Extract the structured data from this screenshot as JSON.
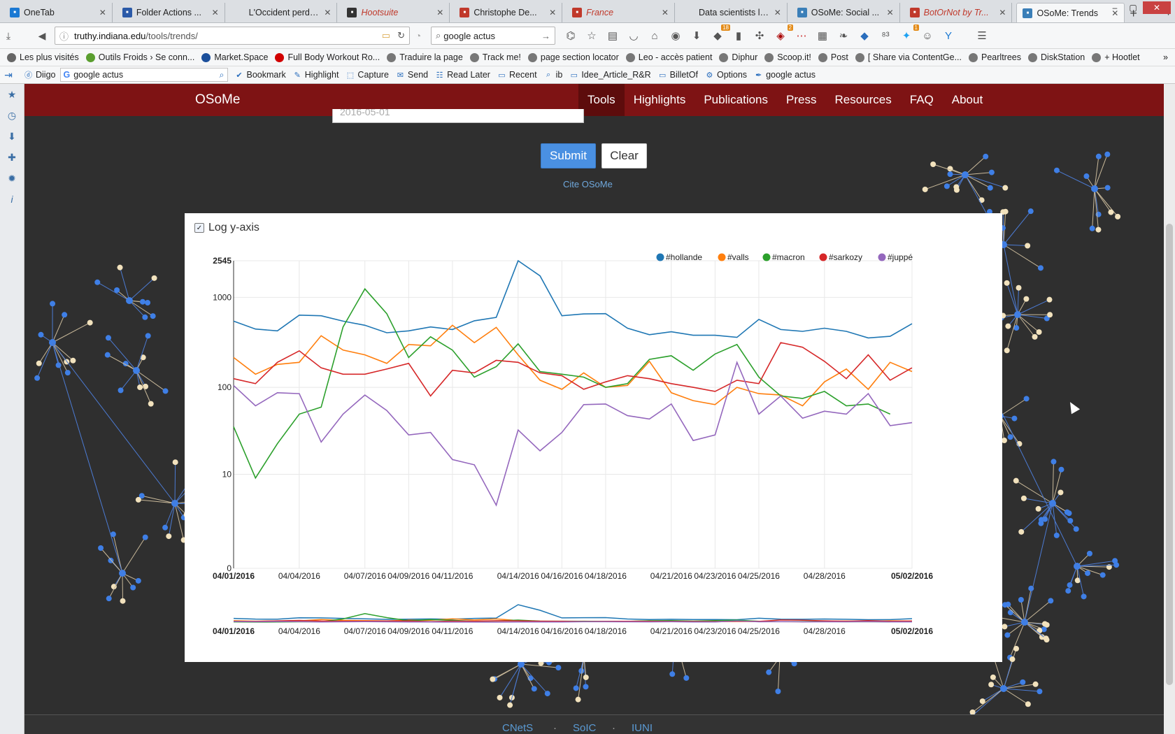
{
  "browser": {
    "tabs": [
      {
        "title": "OneTab",
        "icon": "onetab-icon",
        "color": "#1b79d3",
        "style": ""
      },
      {
        "title": "Folder Actions ...",
        "icon": "folder-icon",
        "color": "#2b5aa8",
        "style": ""
      },
      {
        "title": "L'Occident perdra ?",
        "icon": "",
        "color": "",
        "style": ""
      },
      {
        "title": "Hootsuite",
        "icon": "hootsuite-icon",
        "color": "#333333",
        "style": "red"
      },
      {
        "title": "Christophe De...",
        "icon": "page-icon",
        "color": "#c0392b",
        "style": ""
      },
      {
        "title": "France",
        "icon": "doc-icon",
        "color": "#c0392b",
        "style": "red"
      },
      {
        "title": "Data scientists laun...",
        "icon": "",
        "color": "",
        "style": ""
      },
      {
        "title": "OSoMe: Social ...",
        "icon": "truthy-icon",
        "color": "#3b7fb8",
        "style": ""
      },
      {
        "title": "BotOrNot by Tr...",
        "icon": "bird-icon",
        "color": "#c0392b",
        "style": "red"
      },
      {
        "title": "OSoMe: Trends",
        "icon": "truthy-icon",
        "color": "#3b7fb8",
        "style": "active"
      }
    ],
    "url_host": "truthy.indiana.edu",
    "url_path": "/tools/trends/",
    "search_value": "google actus",
    "badges": {
      "ext1": "18",
      "ext2": "2",
      "ext3": "1"
    },
    "bookmarks": [
      "Les plus visités",
      "Outils Froids › Se conn...",
      "Market.Space",
      "Full Body Workout Ro...",
      "Traduire la page",
      "Track me!",
      "page section locator",
      "Leo - accès patient",
      "Diphur",
      "Scoop.it!",
      "Post",
      "[ Share via ContentGe...",
      "Pearltrees",
      "DiskStation",
      "+ Hootlet"
    ],
    "diigo": {
      "label": "Diigo",
      "search_value": "google actus",
      "items": [
        "Bookmark",
        "Highlight",
        "Capture",
        "Send",
        "Read Later",
        "Recent",
        "ib",
        "Idee_Article_R&R",
        "BilletOf",
        "Options",
        "google  actus"
      ]
    }
  },
  "site": {
    "brand": "OSoMe",
    "nav": [
      "Tools",
      "Highlights",
      "Publications",
      "Press",
      "Resources",
      "FAQ",
      "About"
    ],
    "active_nav": "Tools",
    "date_value": "2016-05-01",
    "submit_label": "Submit",
    "clear_label": "Clear",
    "cite_label": "Cite OSoMe",
    "log_label": "Log y-axis",
    "footer": [
      "CNetS",
      "SoIC",
      "IUNI"
    ],
    "accent_color": "#7e1314",
    "button_color": "#4a90e2"
  },
  "chart_data": {
    "type": "line",
    "log_scale": true,
    "grid": true,
    "legend_position": "top-right",
    "ylim": [
      0,
      2545
    ],
    "yticks": [
      "2545",
      "1000",
      "100",
      "10",
      "0"
    ],
    "xticks": [
      "04/01/2016",
      "04/04/2016",
      "04/07/2016",
      "04/09/2016",
      "04/11/2016",
      "04/14/2016",
      "04/16/2016",
      "04/18/2016",
      "04/21/2016",
      "04/23/2016",
      "04/25/2016",
      "04/28/2016",
      "05/02/2016"
    ],
    "x": [
      "04/01/2016",
      "04/02/2016",
      "04/03/2016",
      "04/04/2016",
      "04/05/2016",
      "04/06/2016",
      "04/07/2016",
      "04/08/2016",
      "04/09/2016",
      "04/10/2016",
      "04/11/2016",
      "04/12/2016",
      "04/13/2016",
      "04/14/2016",
      "04/15/2016",
      "04/16/2016",
      "04/17/2016",
      "04/18/2016",
      "04/19/2016",
      "04/20/2016",
      "04/21/2016",
      "04/22/2016",
      "04/23/2016",
      "04/24/2016",
      "04/25/2016",
      "04/26/2016",
      "04/27/2016",
      "04/28/2016",
      "04/29/2016",
      "04/30/2016",
      "05/01/2016",
      "05/02/2016"
    ],
    "series": [
      {
        "name": "#hollande",
        "color": "#1f77b4",
        "values": [
          545,
          445,
          425,
          635,
          625,
          545,
          490,
          405,
          425,
          470,
          440,
          550,
          600,
          2545,
          1730,
          625,
          655,
          660,
          455,
          385,
          415,
          380,
          380,
          360,
          570,
          440,
          420,
          455,
          420,
          355,
          370,
          510
        ]
      },
      {
        "name": "#valls",
        "color": "#ff7f0e",
        "values": [
          215,
          140,
          180,
          190,
          375,
          260,
          230,
          185,
          300,
          290,
          490,
          315,
          465,
          230,
          120,
          95,
          145,
          100,
          105,
          195,
          87,
          71,
          64,
          100,
          85,
          82,
          62,
          115,
          160,
          95,
          190,
          150
        ]
      },
      {
        "name": "#macron",
        "color": "#2ca02c",
        "values": [
          36,
          9,
          23,
          50,
          60,
          470,
          1240,
          660,
          215,
          365,
          260,
          130,
          170,
          305,
          150,
          140,
          130,
          100,
          110,
          205,
          225,
          155,
          235,
          300,
          130,
          80,
          75,
          90,
          62,
          65,
          50
        ]
      },
      {
        "name": "#sarkozy",
        "color": "#d62728",
        "values": [
          125,
          110,
          190,
          255,
          165,
          140,
          140,
          160,
          185,
          80,
          155,
          145,
          200,
          190,
          145,
          135,
          95,
          115,
          135,
          125,
          110,
          100,
          90,
          120,
          110,
          315,
          280,
          195,
          125,
          230,
          120,
          165
        ]
      },
      {
        "name": "#juppé",
        "color": "#9467bd",
        "values": [
          105,
          62,
          87,
          85,
          24,
          50,
          82,
          55,
          29,
          31,
          15,
          13,
          4,
          33,
          19,
          31,
          64,
          65,
          48,
          44,
          65,
          25,
          29,
          190,
          50,
          80,
          45,
          54,
          50,
          85,
          37,
          40
        ]
      }
    ]
  }
}
